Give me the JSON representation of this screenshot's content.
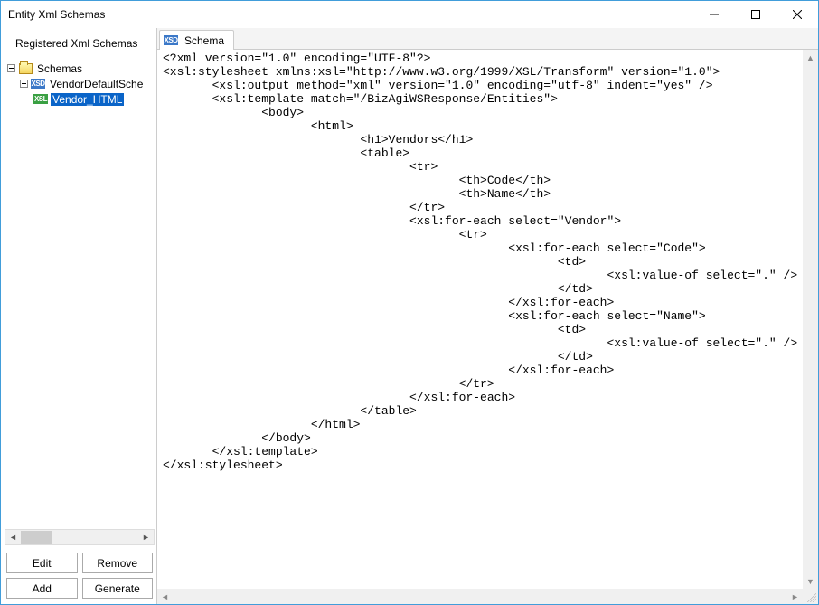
{
  "window": {
    "title": "Entity Xml Schemas"
  },
  "sidebar": {
    "heading": "Registered Xml Schemas",
    "tree": {
      "root_label": "Schemas",
      "xsd_label": "VendorDefaultSche",
      "xsl_label": "Vendor_HTML"
    },
    "icons": {
      "xsd": "XSD",
      "xsl": "XSL"
    },
    "buttons": {
      "edit": "Edit",
      "remove": "Remove",
      "add": "Add",
      "generate": "Generate"
    }
  },
  "tab": {
    "label": "Schema",
    "icon": "XSD"
  },
  "code": "<?xml version=\"1.0\" encoding=\"UTF-8\"?>\n<xsl:stylesheet xmlns:xsl=\"http://www.w3.org/1999/XSL/Transform\" version=\"1.0\">\n       <xsl:output method=\"xml\" version=\"1.0\" encoding=\"utf-8\" indent=\"yes\" />\n       <xsl:template match=\"/BizAgiWSResponse/Entities\">\n              <body>\n                     <html>\n                            <h1>Vendors</h1>\n                            <table>\n                                   <tr>\n                                          <th>Code</th>\n                                          <th>Name</th>\n                                   </tr>\n                                   <xsl:for-each select=\"Vendor\">\n                                          <tr>\n                                                 <xsl:for-each select=\"Code\">\n                                                        <td>\n                                                               <xsl:value-of select=\".\" />\n                                                        </td>\n                                                 </xsl:for-each>\n                                                 <xsl:for-each select=\"Name\">\n                                                        <td>\n                                                               <xsl:value-of select=\".\" />\n                                                        </td>\n                                                 </xsl:for-each>\n                                          </tr>\n                                   </xsl:for-each>\n                            </table>\n                     </html>\n              </body>\n       </xsl:template>\n</xsl:stylesheet>"
}
